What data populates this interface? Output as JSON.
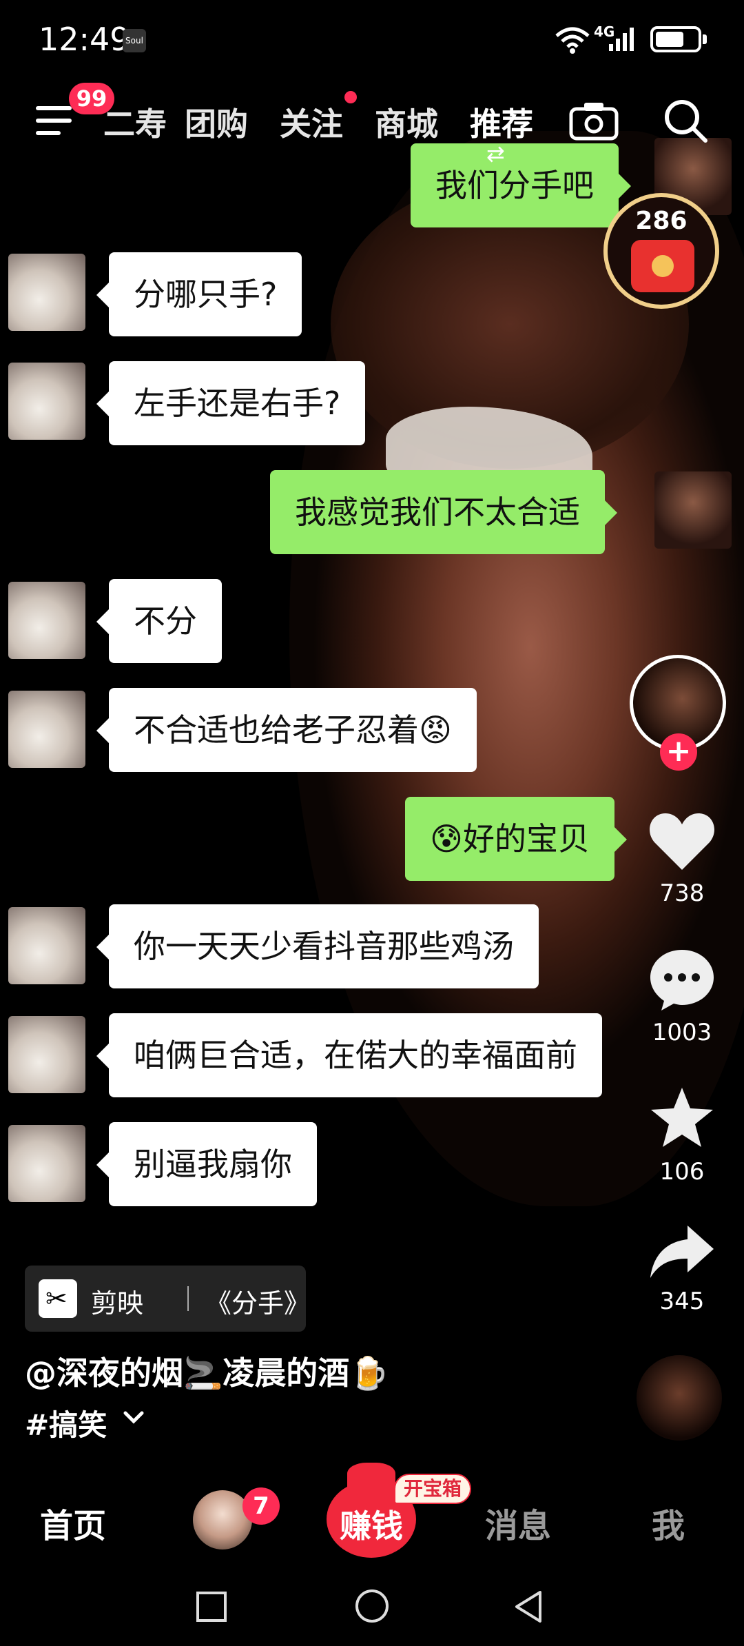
{
  "status_bar": {
    "time": "12:49",
    "app_icon": "Soul",
    "network": "4G"
  },
  "top_nav": {
    "menu_badge": "99",
    "tabs": [
      "二寿",
      "团购",
      "关注",
      "商城",
      "推荐"
    ],
    "active_tab": "推荐"
  },
  "red_packet": {
    "count": "286"
  },
  "chat": {
    "messages": [
      {
        "side": "right",
        "text": "我们分手吧"
      },
      {
        "side": "left",
        "text": "分哪只手?"
      },
      {
        "side": "left",
        "text": "左手还是右手?"
      },
      {
        "side": "right",
        "text": "我感觉我们不太合适"
      },
      {
        "side": "left",
        "text": "不分"
      },
      {
        "side": "left",
        "text": "不合适也给老子忍着😡"
      },
      {
        "side": "right",
        "text": "😰好的宝贝"
      },
      {
        "side": "left",
        "text": "你一天天少看抖音那些鸡汤"
      },
      {
        "side": "left",
        "text": "咱俩巨合适，在偌大的幸福面前"
      },
      {
        "side": "left",
        "text": "别逼我扇你"
      }
    ]
  },
  "actions": {
    "like_count": "738",
    "comment_count": "1003",
    "favorite_count": "106",
    "share_count": "345"
  },
  "capcut": {
    "app": "剪映",
    "title": "《分手》"
  },
  "video_info": {
    "author": "@深夜的烟🚬凌晨的酒🍺",
    "hashtag": "#搞笑"
  },
  "tab_bar": {
    "home": "首页",
    "friends_badge": "7",
    "earn": "赚钱",
    "treasure": "开宝箱",
    "messages": "消息",
    "me": "我"
  },
  "colors": {
    "accent": "#fe2c55",
    "bubble_green": "#95ec69",
    "earn_red": "#f0283c"
  }
}
